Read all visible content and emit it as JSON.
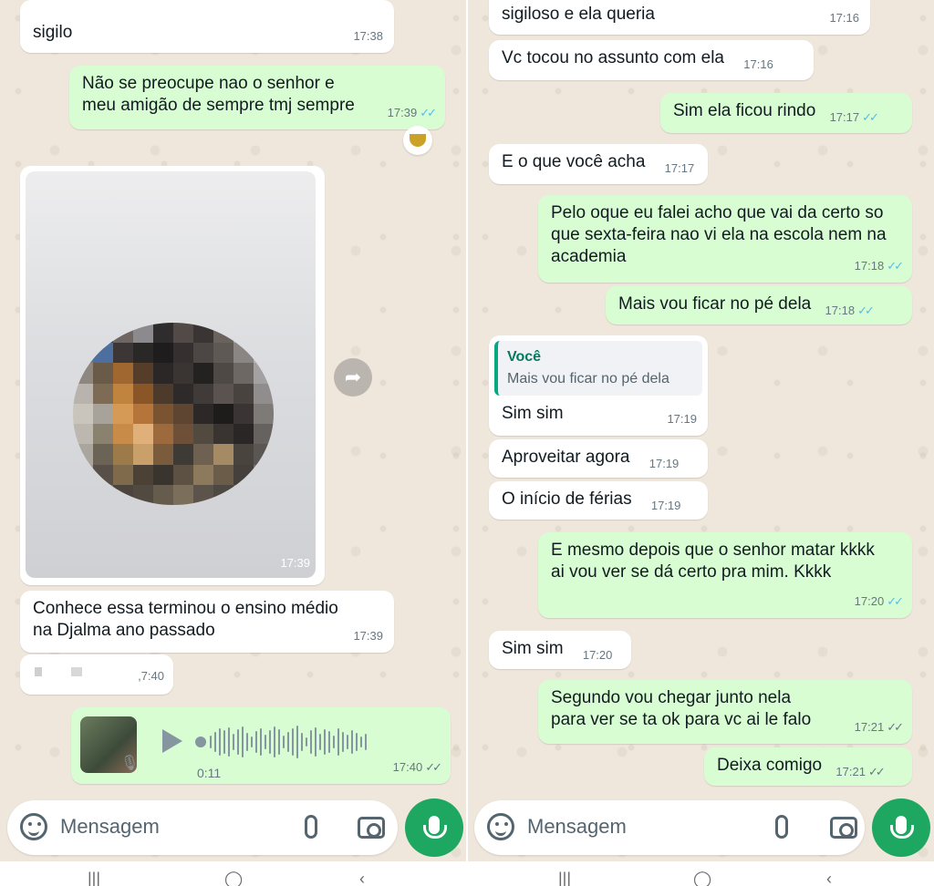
{
  "left": {
    "messages": [
      {
        "id": "m1",
        "dir": "in",
        "text": "sigilo",
        "time": "17:38"
      },
      {
        "id": "m2",
        "dir": "out",
        "text": "Não se preocupe nao o senhor e meu amigão de sempre tmj sempre",
        "time": "17:39",
        "ticks": "✓✓"
      },
      {
        "id": "m3",
        "dir": "in",
        "type": "image",
        "time": "17:39"
      },
      {
        "id": "m4",
        "dir": "in",
        "text": "Conhece essa terminou o ensino médio na Djalma ano passado",
        "time": "17:39"
      },
      {
        "id": "m5",
        "dir": "in",
        "text": "",
        "time": ",7:40"
      },
      {
        "id": "m6",
        "dir": "out",
        "type": "audio",
        "duration": "0:11",
        "time": "17:40",
        "ticks": "✓✓"
      }
    ],
    "composer": {
      "placeholder": "Mensagem"
    }
  },
  "right": {
    "messages": [
      {
        "id": "r0",
        "dir": "in",
        "text": "sigiloso e ela queria",
        "time": "17:16"
      },
      {
        "id": "r1",
        "dir": "in",
        "text": "Vc tocou no assunto com ela",
        "time": "17:16"
      },
      {
        "id": "r2",
        "dir": "out",
        "text": "Sim ela ficou rindo",
        "time": "17:17",
        "ticks": "✓✓"
      },
      {
        "id": "r3",
        "dir": "in",
        "text": "E o que você acha",
        "time": "17:17"
      },
      {
        "id": "r4",
        "dir": "out",
        "text": "Pelo oque eu falei acho que vai da certo so que sexta-feira nao vi ela na escola nem na academia",
        "time": "17:18",
        "ticks": "✓✓"
      },
      {
        "id": "r5",
        "dir": "out",
        "text": "Mais vou ficar no pé dela",
        "time": "17:18",
        "ticks": "✓✓"
      },
      {
        "id": "r6",
        "dir": "in",
        "quote_author": "Você",
        "quote_text": "Mais vou ficar no pé dela",
        "text": "Sim sim",
        "time": "17:19"
      },
      {
        "id": "r7",
        "dir": "in",
        "text": "Aproveitar agora",
        "time": "17:19"
      },
      {
        "id": "r8",
        "dir": "in",
        "text": "O início de férias",
        "time": "17:19"
      },
      {
        "id": "r9",
        "dir": "out",
        "text": "E mesmo depois que o senhor matar kkkk ai vou ver se dá certo pra mim. Kkkk",
        "time": "17:20",
        "ticks": "✓✓"
      },
      {
        "id": "r10",
        "dir": "in",
        "text": "Sim sim",
        "time": "17:20"
      },
      {
        "id": "r11",
        "dir": "out",
        "text": "Segundo vou chegar junto nela para ver se ta ok para vc ai le falo",
        "time": "17:21",
        "ticks": "✓✓"
      },
      {
        "id": "r12",
        "dir": "out",
        "text": "Deixa comigo",
        "time": "17:21",
        "ticks": "✓✓"
      }
    ],
    "composer": {
      "placeholder": "Mensagem"
    }
  },
  "colors": {
    "incoming": "#ffffff",
    "outgoing": "#d9fdd3",
    "accent": "#1da760",
    "read_ticks": "#53bdeb"
  },
  "icons": [
    "emoji-icon",
    "attach-icon",
    "camera-icon",
    "mic-icon",
    "play-icon",
    "forward-icon"
  ]
}
